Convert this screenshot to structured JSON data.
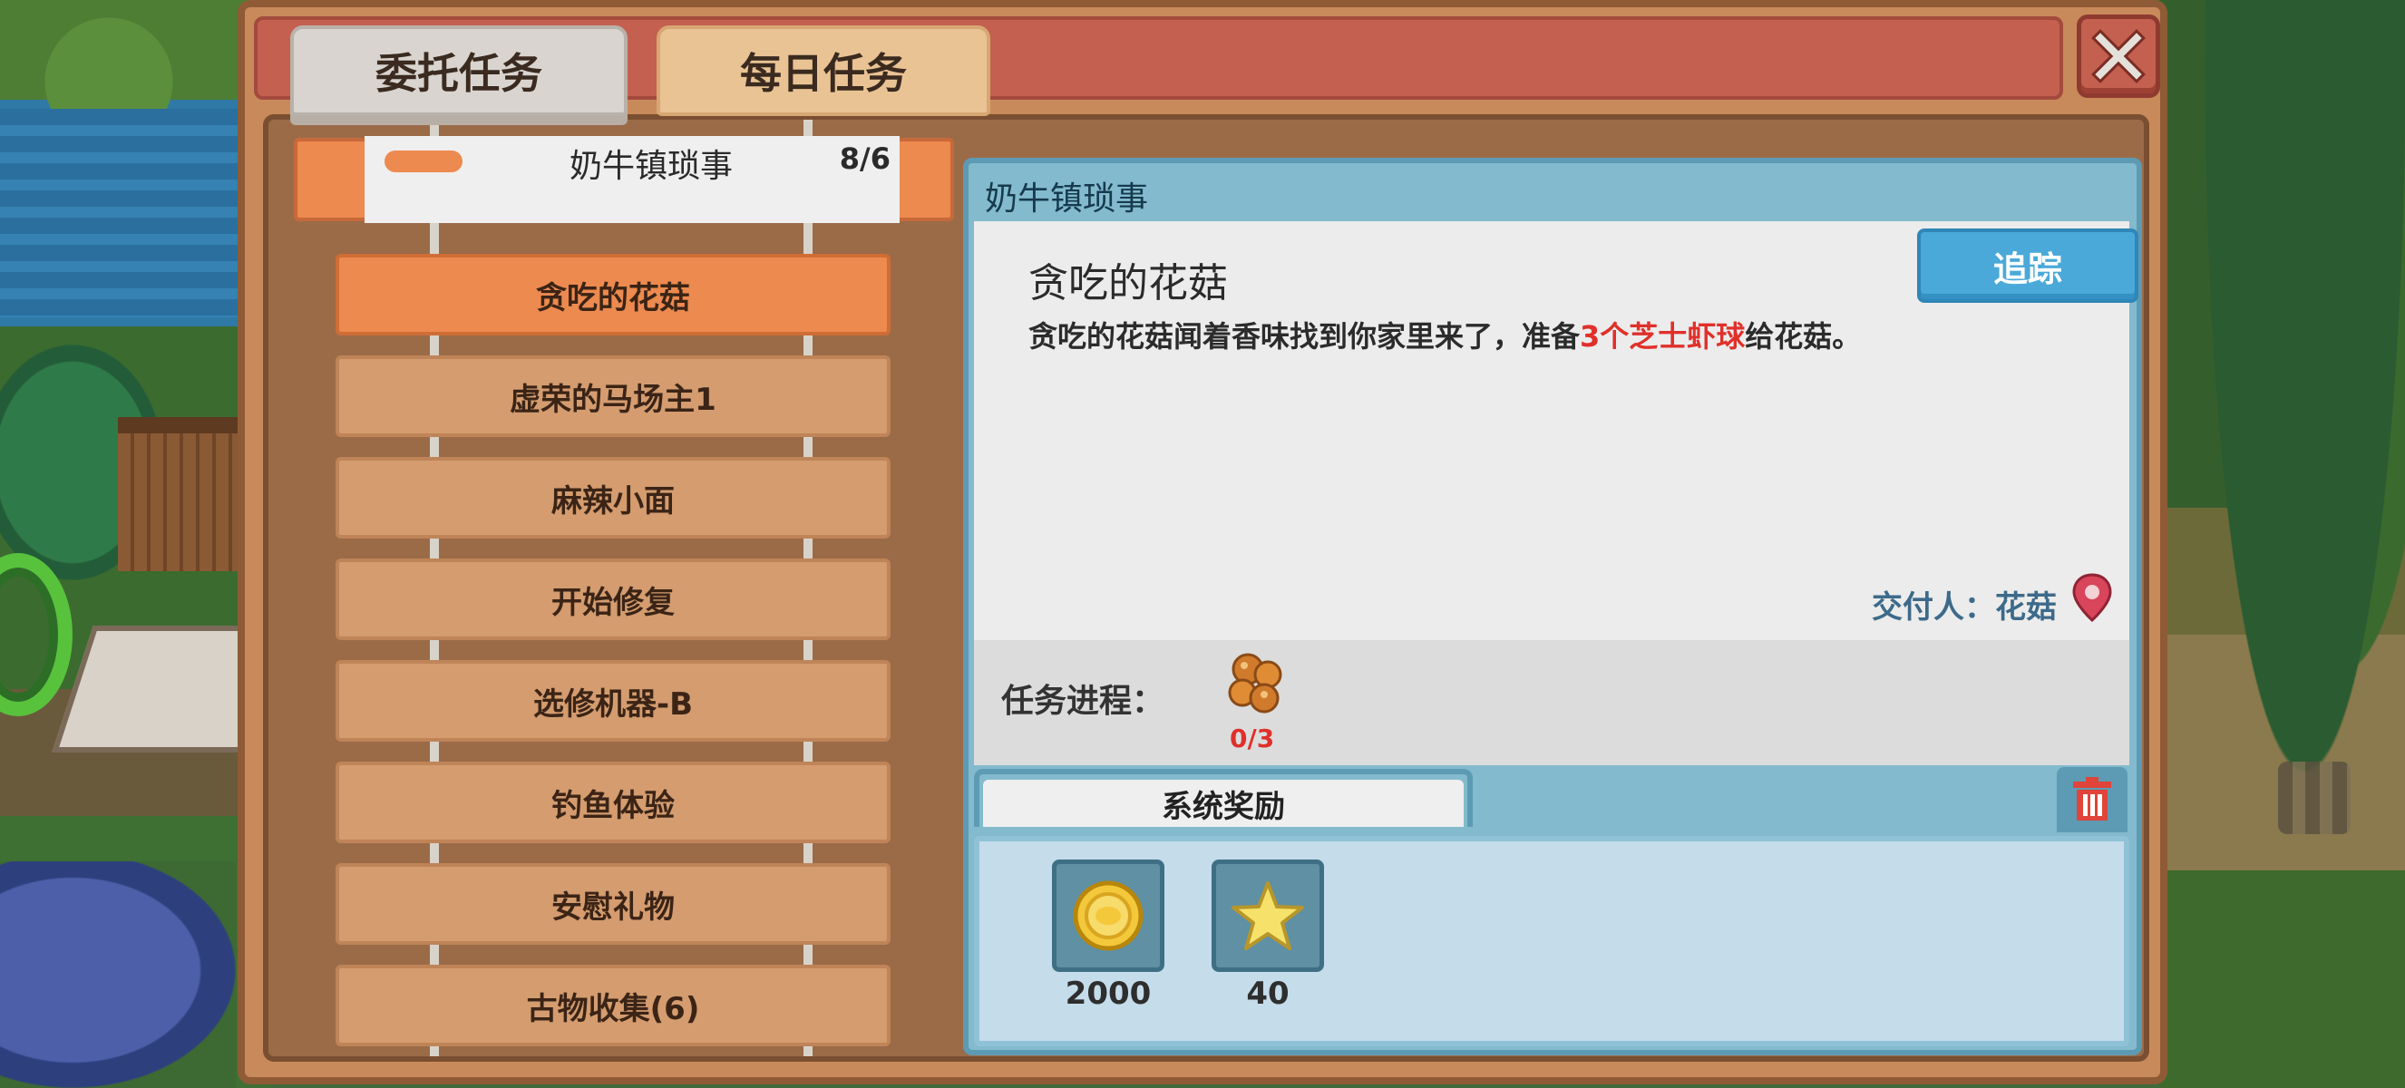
{
  "tabs": {
    "commission": "委托任务",
    "daily": "每日任务"
  },
  "chapter": {
    "title": "奶牛镇琐事",
    "count": "8/6"
  },
  "quests": [
    {
      "label": "贪吃的花菇",
      "active": true
    },
    {
      "label": "虚荣的马场主1",
      "active": false
    },
    {
      "label": "麻辣小面",
      "active": false
    },
    {
      "label": "开始修复",
      "active": false
    },
    {
      "label": "选修机器-B",
      "active": false
    },
    {
      "label": "钓鱼体验",
      "active": false
    },
    {
      "label": "安慰礼物",
      "active": false
    },
    {
      "label": "古物收集(6)",
      "active": false
    }
  ],
  "detail": {
    "header": "奶牛镇琐事",
    "quest_name": "贪吃的花菇",
    "desc_before": "贪吃的花菇闻着香味找到你家里来了，准备",
    "desc_highlight": "3个芝士虾球",
    "desc_after": "给花菇。",
    "track_button": "追踪",
    "giver": "交付人：花菇",
    "progress_label": "任务进程：",
    "progress_count": "0/3",
    "rewards_tab": "系统奖励",
    "rewards": [
      {
        "icon": "gold-coin-icon",
        "amount": "2000"
      },
      {
        "icon": "star-icon",
        "amount": "40"
      }
    ]
  },
  "colors": {
    "panel": "#c98a5b",
    "title_strip": "#c4604f",
    "active_quest": "#ec8a4f",
    "quest": "#d49c6f",
    "highlight_text": "#e0302a",
    "track_button": "#4aa9d8"
  }
}
